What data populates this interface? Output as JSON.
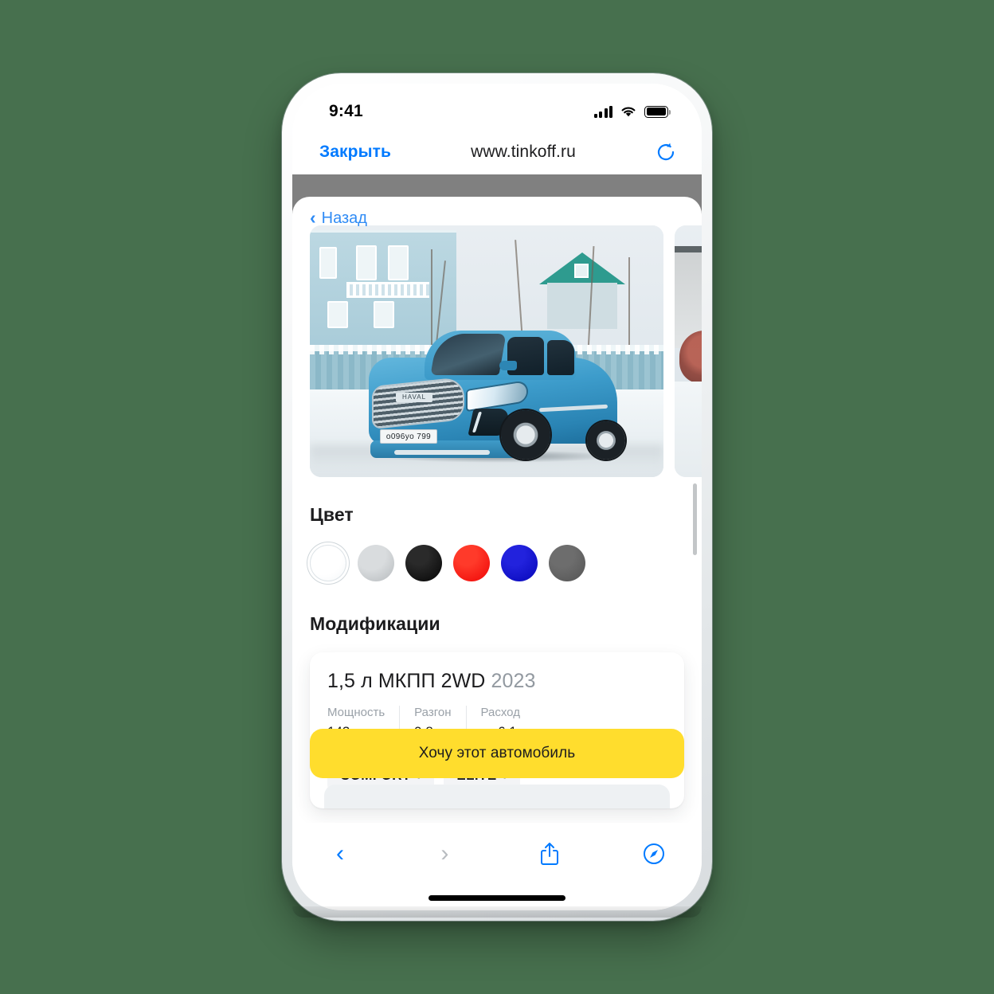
{
  "status_bar": {
    "time": "9:41",
    "cellular_icon": "signal-bars-icon",
    "wifi_icon": "wifi-icon",
    "battery_icon": "battery-icon"
  },
  "browser": {
    "close_label": "Закрыть",
    "url": "www.tinkoff.ru",
    "reload_icon": "reload-icon",
    "toolbar": {
      "back_icon": "chevron-left-icon",
      "forward_icon": "chevron-right-icon",
      "share_icon": "share-icon",
      "tabs_icon": "compass-icon"
    }
  },
  "page": {
    "back_link": "Назад",
    "gallery": {
      "main_photo_alt": "Голубой HAVAL Jolion во дворе зимой",
      "license_plate": "o096yo 799",
      "brand_badge": "HAVAL",
      "next_photo_alt": "Второе фото автомобиля"
    },
    "colors": {
      "title": "Цвет",
      "items": [
        {
          "name": "Белый",
          "hex": "#ffffff",
          "selected": true
        },
        {
          "name": "Серебряный",
          "hex": "#bdbdbd",
          "selected": false
        },
        {
          "name": "Чёрный",
          "hex": "#050505",
          "selected": false
        },
        {
          "name": "Красный",
          "hex": "#f00d0d",
          "selected": false
        },
        {
          "name": "Синий",
          "hex": "#0a0ac8",
          "selected": false
        },
        {
          "name": "Серый",
          "hex": "#5a5a5a",
          "selected": false
        }
      ]
    },
    "modifications": {
      "title": "Модификации",
      "card": {
        "name": "1,5 л МКПП 2WD",
        "year": "2023",
        "specs": [
          {
            "label": "Мощность",
            "value": "143 л.с."
          },
          {
            "label": "Разгон",
            "value": "9,8 с"
          },
          {
            "label": "Расход",
            "value": "от 6,1 л"
          }
        ],
        "trims": [
          {
            "label": "COMFORT",
            "chevron": "›"
          },
          {
            "label": "ELITE",
            "chevron": "›"
          }
        ]
      }
    },
    "cta_label": "Хочу этот автомобиль"
  },
  "theme": {
    "background": "#47704e",
    "accent_blue": "#007aff",
    "brand_yellow": "#ffdd2d",
    "chrome_grey": "#808080"
  }
}
